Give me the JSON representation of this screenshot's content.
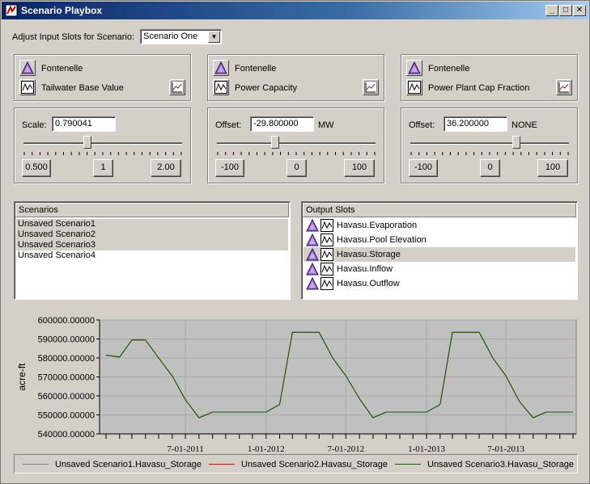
{
  "window": {
    "title": "Scenario Playbox"
  },
  "controls": {
    "adjust_label": "Adjust Input Slots for Scenario:",
    "scenario_selected": "Scenario One"
  },
  "panels": [
    {
      "object": "Fontenelle",
      "slot": "Tailwater Base Value",
      "field_label": "Scale:",
      "field_value": "0.790041",
      "unit": "",
      "buttons": [
        "0.500",
        "1",
        "2.00"
      ],
      "slider_fraction": 0.4
    },
    {
      "object": "Fontenelle",
      "slot": "Power Capacity",
      "field_label": "Offset:",
      "field_value": "-29.800000",
      "unit": "MW",
      "buttons": [
        "-100",
        "0",
        "100"
      ],
      "slider_fraction": 0.36
    },
    {
      "object": "Fontenelle",
      "slot": "Power Plant Cap Fraction",
      "field_label": "Offset:",
      "field_value": "36.200000",
      "unit": "NONE",
      "buttons": [
        "-100",
        "0",
        "100"
      ],
      "slider_fraction": 0.68
    }
  ],
  "scenarios": {
    "header": "Scenarios",
    "items": [
      "Unsaved Scenario1",
      "Unsaved Scenario2",
      "Unsaved Scenario3",
      "Unsaved Scenario4"
    ],
    "selected": [
      0,
      1,
      2
    ]
  },
  "output_slots": {
    "header": "Output Slots",
    "items": [
      "Havasu.Evaporation",
      "Havasu.Pool Elevation",
      "Havasu.Storage",
      "Havasu.Inflow",
      "Havasu.Outflow"
    ],
    "selected": 2
  },
  "colors": {
    "series_gray": "#808080",
    "series_red": "#ff0000",
    "series_green": "#006400",
    "plot_bg": "#c0c0c0",
    "accent_purple": "#8040c0"
  },
  "chart_data": {
    "type": "line",
    "ylabel": "acre-ft",
    "ylim": [
      540000,
      600000
    ],
    "yticks": [
      "600000.00000",
      "590000.00000",
      "580000.00000",
      "570000.00000",
      "560000.00000",
      "550000.00000",
      "540000.00000"
    ],
    "xlim": [
      "2011-01-01",
      "2013-12-01"
    ],
    "xtick_labels": [
      {
        "label": "7-01-2011",
        "date": "2011-07-01"
      },
      {
        "label": "1-01-2012",
        "date": "2012-01-01"
      },
      {
        "label": "7-01-2012",
        "date": "2012-07-01"
      },
      {
        "label": "1-01-2013",
        "date": "2013-01-01"
      },
      {
        "label": "7-01-2013",
        "date": "2013-07-01"
      }
    ],
    "x": [
      "2011-01-01",
      "2011-02-01",
      "2011-03-01",
      "2011-04-01",
      "2011-05-01",
      "2011-06-01",
      "2011-07-01",
      "2011-08-01",
      "2011-09-01",
      "2011-10-01",
      "2011-11-01",
      "2011-12-01",
      "2012-01-01",
      "2012-02-01",
      "2012-03-01",
      "2012-04-01",
      "2012-05-01",
      "2012-06-01",
      "2012-07-01",
      "2012-08-01",
      "2012-09-01",
      "2012-10-01",
      "2012-11-01",
      "2012-12-01",
      "2013-01-01",
      "2013-02-01",
      "2013-03-01",
      "2013-04-01",
      "2013-05-01",
      "2013-06-01",
      "2013-07-01",
      "2013-08-01",
      "2013-09-01",
      "2013-10-01",
      "2013-11-01",
      "2013-12-01"
    ],
    "series": [
      {
        "name": "Unsaved Scenario1.Havasu_Storage",
        "color": "#808080",
        "values": [
          581500,
          580500,
          589500,
          589500,
          580000,
          570500,
          558000,
          548500,
          551500,
          551500,
          551500,
          551500,
          551500,
          555500,
          593500,
          593500,
          593500,
          580000,
          570500,
          558500,
          548500,
          551500,
          551500,
          551500,
          551500,
          555500,
          593500,
          593500,
          593500,
          580000,
          570500,
          557000,
          548500,
          551500,
          551500,
          551500
        ]
      },
      {
        "name": "Unsaved Scenario2.Havasu_Storage",
        "color": "#ff0000",
        "values": [
          581500,
          580500,
          589500,
          589500,
          580000,
          570500,
          558000,
          548500,
          551500,
          551500,
          551500,
          551500,
          551500,
          555500,
          593500,
          593500,
          593500,
          580000,
          570500,
          558500,
          548500,
          551500,
          551500,
          551500,
          551500,
          555500,
          593500,
          593500,
          593500,
          580000,
          570500,
          557000,
          548500,
          551500,
          551500,
          551500
        ]
      },
      {
        "name": "Unsaved Scenario3.Havasu_Storage",
        "color": "#006400",
        "values": [
          581500,
          580500,
          589500,
          589500,
          580000,
          570500,
          558000,
          548500,
          551500,
          551500,
          551500,
          551500,
          551500,
          555500,
          593500,
          593500,
          593500,
          580000,
          570500,
          558500,
          548500,
          551500,
          551500,
          551500,
          551500,
          555500,
          593500,
          593500,
          593500,
          580000,
          570500,
          557000,
          548500,
          551500,
          551500,
          551500
        ]
      }
    ]
  }
}
